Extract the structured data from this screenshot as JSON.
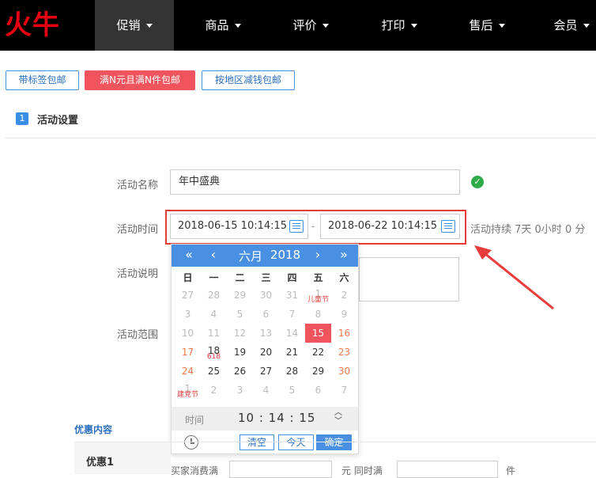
{
  "logo": {
    "text": "火牛"
  },
  "nav": [
    {
      "label": "促销",
      "active": true
    },
    {
      "label": "商品"
    },
    {
      "label": "评价"
    },
    {
      "label": "打印"
    },
    {
      "label": "售后"
    },
    {
      "label": "会员"
    }
  ],
  "tabs": [
    "带标签包邮",
    "满N元且满N件包邮",
    "按地区减钱包邮"
  ],
  "step": {
    "number": "1",
    "title": "活动设置"
  },
  "form": {
    "name_label": "活动名称",
    "name_value": "年中盛典",
    "time_label": "活动时间",
    "start_time": "2018-06-15 10:14:15",
    "end_time": "2018-06-22 10:14:15",
    "dash": "-",
    "duration": "活动持续 7天 0小时 0 分",
    "desc_label": "活动说明",
    "scope_label": "活动范围"
  },
  "calendar": {
    "prev_year": "«",
    "prev_month": "‹",
    "month": "六月",
    "year": "2018",
    "next_month": "›",
    "next_year": "»",
    "weekdays": [
      "日",
      "一",
      "二",
      "三",
      "四",
      "五",
      "六"
    ],
    "weeks": [
      [
        {
          "d": "27",
          "o": 1
        },
        {
          "d": "28",
          "o": 1
        },
        {
          "d": "29",
          "o": 1
        },
        {
          "d": "30",
          "o": 1
        },
        {
          "d": "31",
          "o": 1
        },
        {
          "d": "1",
          "o": 1,
          "h": "儿童节"
        },
        {
          "d": "2",
          "o": 1
        }
      ],
      [
        {
          "d": "3",
          "o": 1
        },
        {
          "d": "4",
          "o": 1
        },
        {
          "d": "5",
          "o": 1
        },
        {
          "d": "6",
          "o": 1
        },
        {
          "d": "7",
          "o": 1
        },
        {
          "d": "8",
          "o": 1
        },
        {
          "d": "9",
          "o": 1
        }
      ],
      [
        {
          "d": "10",
          "o": 1
        },
        {
          "d": "11",
          "o": 1
        },
        {
          "d": "12",
          "o": 1
        },
        {
          "d": "13",
          "o": 1
        },
        {
          "d": "14",
          "o": 1
        },
        {
          "d": "15",
          "s": 1
        },
        {
          "d": "16",
          "w": 1
        }
      ],
      [
        {
          "d": "17",
          "w": 1
        },
        {
          "d": "18",
          "h": "618"
        },
        {
          "d": "19"
        },
        {
          "d": "20"
        },
        {
          "d": "21"
        },
        {
          "d": "22"
        },
        {
          "d": "23",
          "w": 1
        }
      ],
      [
        {
          "d": "24",
          "w": 1
        },
        {
          "d": "25"
        },
        {
          "d": "26"
        },
        {
          "d": "27"
        },
        {
          "d": "28"
        },
        {
          "d": "29"
        },
        {
          "d": "30",
          "w": 1
        }
      ],
      [
        {
          "d": "1",
          "o": 1,
          "h": "建党节"
        },
        {
          "d": "2",
          "o": 1
        },
        {
          "d": "3",
          "o": 1
        },
        {
          "d": "4",
          "o": 1
        },
        {
          "d": "5",
          "o": 1
        },
        {
          "d": "6",
          "o": 1
        },
        {
          "d": "7",
          "o": 1
        }
      ]
    ],
    "time_label": "时间",
    "time_value": "10 : 14 : 15",
    "clear": "清空",
    "today": "今天",
    "confirm": "确定"
  },
  "promo": {
    "section_title": "优惠内容",
    "item_label": "优惠1",
    "text1": "买家消费满",
    "text2": "元  同时满",
    "text3": "件"
  },
  "colors": {
    "accent": "#4a90e2",
    "danger": "#f0545c",
    "brand": "#e60012"
  }
}
